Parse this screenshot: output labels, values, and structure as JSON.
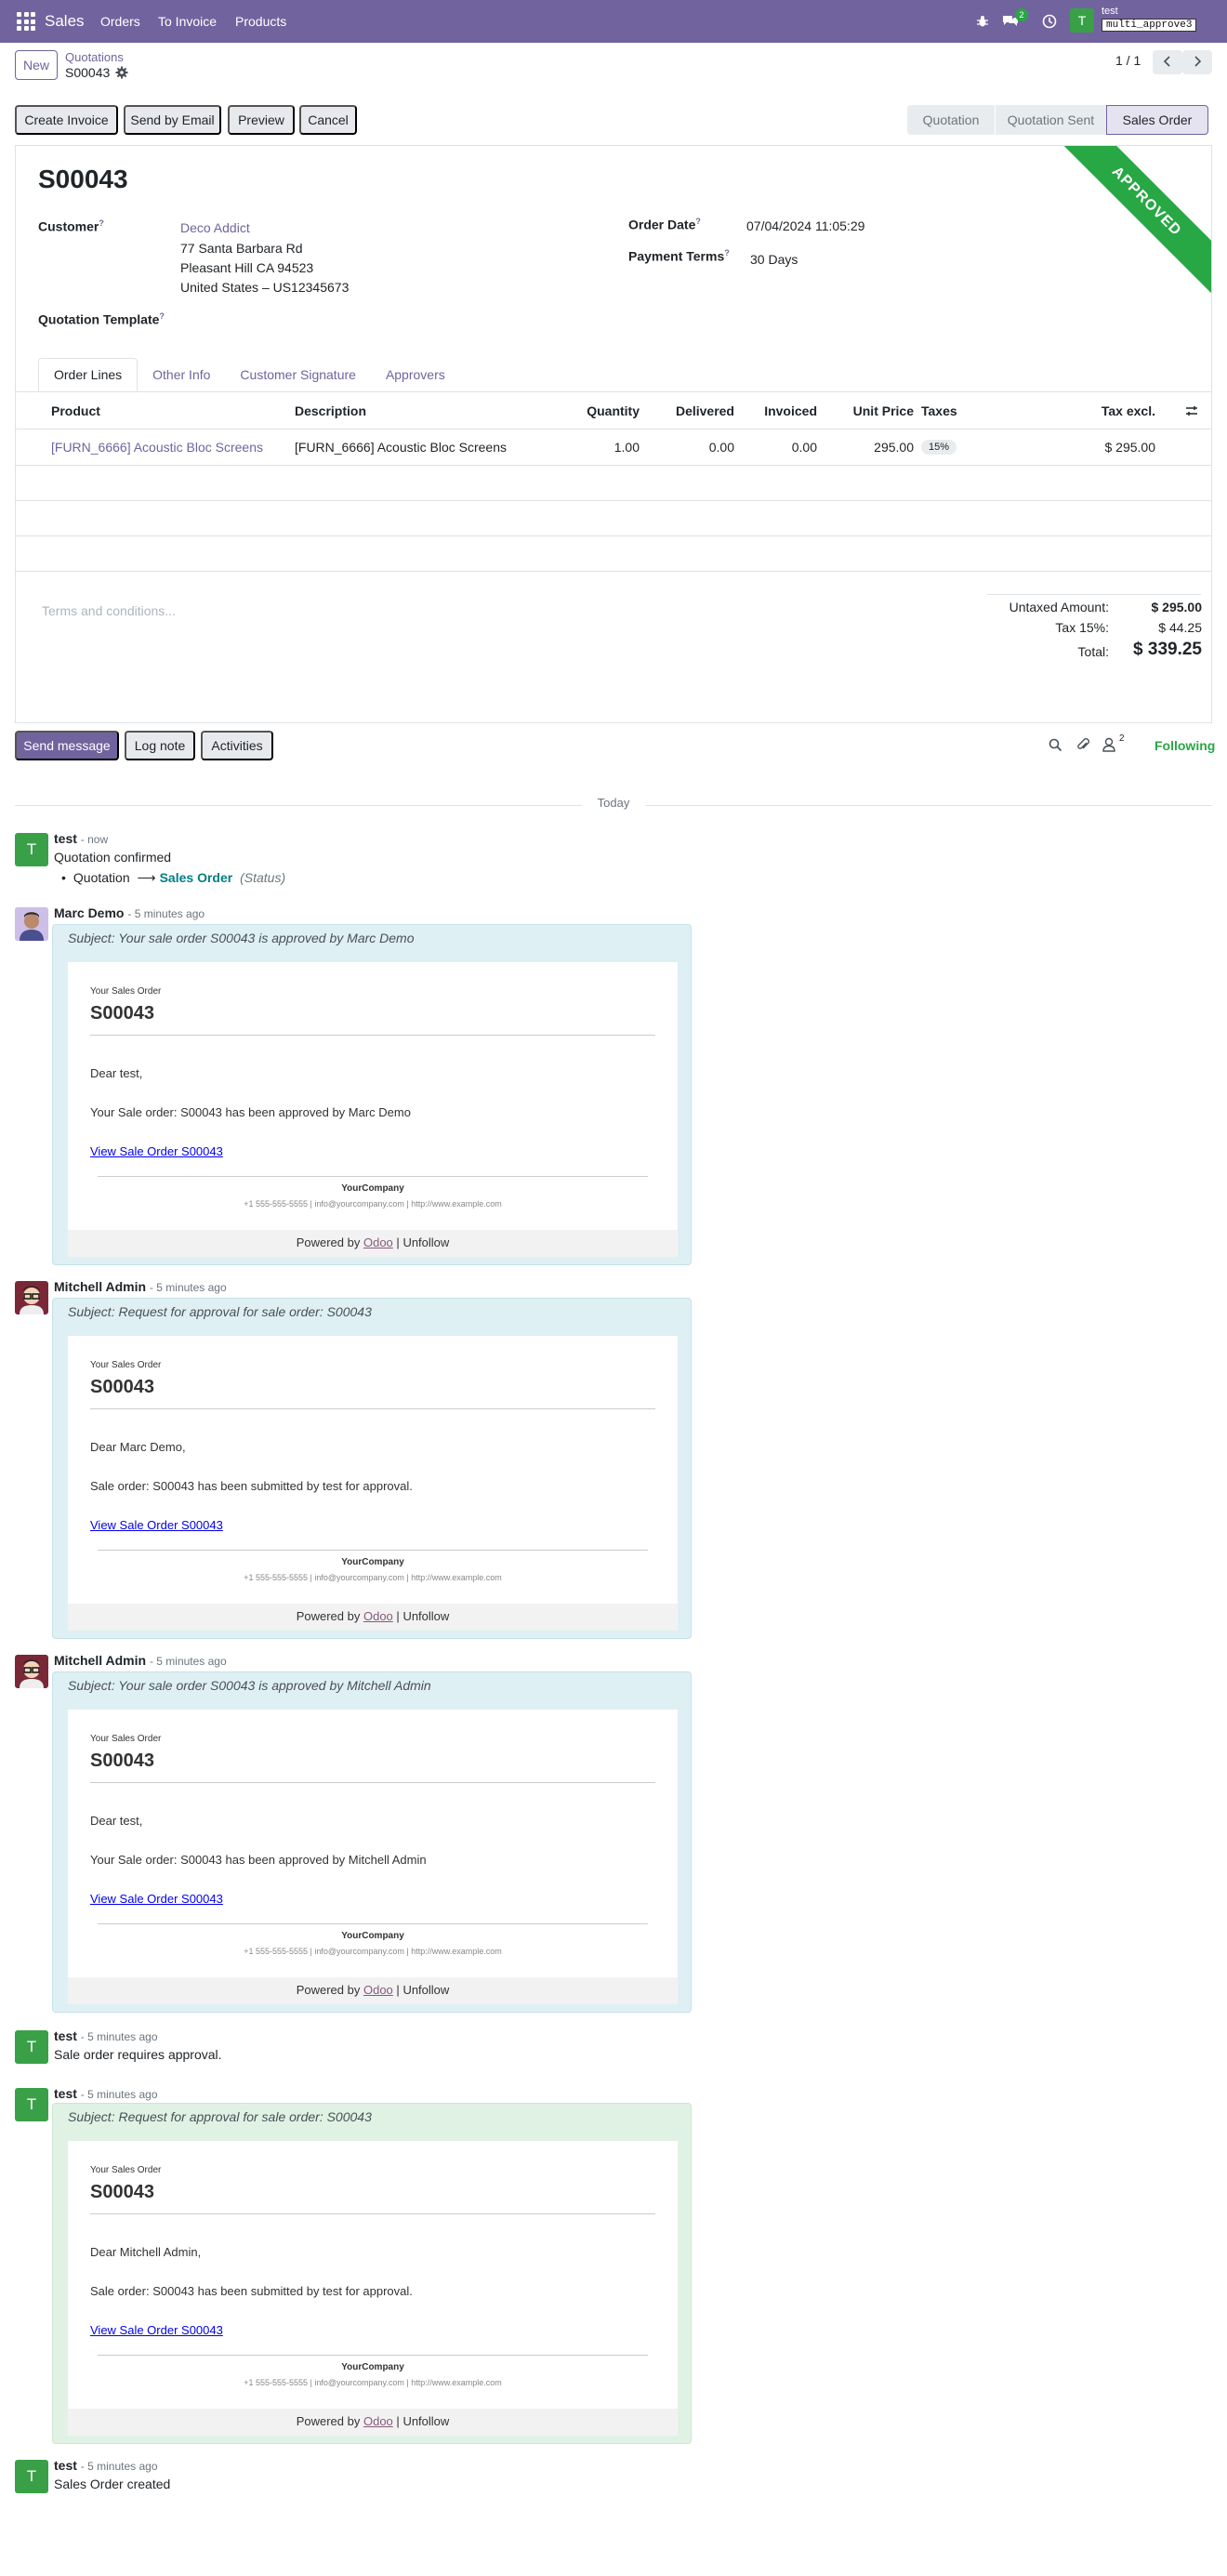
{
  "navbar": {
    "app": "Sales",
    "menu": [
      "Orders",
      "To Invoice",
      "Products"
    ],
    "chat_badge": "2",
    "avatar_letter": "T",
    "user": "test",
    "database": "multi_approve3"
  },
  "control": {
    "new_label": "New",
    "breadcrumb_parent": "Quotations",
    "breadcrumb_current": "S00043",
    "pager": "1 / 1"
  },
  "actions": {
    "create_invoice": "Create Invoice",
    "send_email": "Send by Email",
    "preview": "Preview",
    "cancel": "Cancel"
  },
  "statusbar": [
    "Quotation",
    "Quotation Sent",
    "Sales Order"
  ],
  "form": {
    "ribbon": "APPROVED",
    "name": "S00043",
    "customer_label": "Customer",
    "customer_name": "Deco Addict",
    "address1": "77 Santa Barbara Rd",
    "address2": "Pleasant Hill CA 94523",
    "address3": "United States – US12345673",
    "template_label": "Quotation Template",
    "order_date_label": "Order Date",
    "order_date": "07/04/2024 11:05:29",
    "payment_terms_label": "Payment Terms",
    "payment_terms": "30 Days",
    "help_mark": "?"
  },
  "tabs": [
    "Order Lines",
    "Other Info",
    "Customer Signature",
    "Approvers"
  ],
  "lines": {
    "headers": {
      "product": "Product",
      "description": "Description",
      "quantity": "Quantity",
      "delivered": "Delivered",
      "invoiced": "Invoiced",
      "unit_price": "Unit Price",
      "taxes": "Taxes",
      "tax_excl": "Tax excl."
    },
    "row": {
      "product": "[FURN_6666] Acoustic Bloc Screens",
      "description": "[FURN_6666] Acoustic Bloc Screens",
      "quantity": "1.00",
      "delivered": "0.00",
      "invoiced": "0.00",
      "unit_price": "295.00",
      "taxes": "15%",
      "tax_excl": "$ 295.00"
    }
  },
  "terms_placeholder": "Terms and conditions...",
  "totals": {
    "untaxed_label": "Untaxed Amount:",
    "untaxed": "$ 295.00",
    "tax_label": "Tax 15%:",
    "tax": "$ 44.25",
    "total_label": "Total:",
    "total": "$ 339.25"
  },
  "chatter": {
    "send_message": "Send message",
    "log_note": "Log note",
    "activities": "Activities",
    "followers_count": "2",
    "following": "Following",
    "today": "Today"
  },
  "messages": {
    "m1": {
      "author": "test",
      "ago": "- now",
      "text": "Quotation confirmed",
      "from": "Quotation",
      "to": "Sales Order",
      "field": "(Status)"
    },
    "m2": {
      "author": "Marc Demo",
      "ago": "- 5 minutes ago",
      "subject": "Subject: Your sale order S00043 is approved by Marc Demo",
      "small": "Your Sales Order",
      "title": "S00043",
      "greeting": "Dear test,",
      "body": "Your Sale order: S00043 has been approved by Marc Demo",
      "link": "View Sale Order S00043"
    },
    "m3": {
      "author": "Mitchell Admin",
      "ago": "- 5 minutes ago",
      "subject": "Subject: Request for approval for sale order: S00043",
      "small": "Your Sales Order",
      "title": "S00043",
      "greeting": "Dear Marc Demo,",
      "body": "Sale order: S00043 has been submitted by test for approval.",
      "link": "View Sale Order S00043"
    },
    "m4": {
      "author": "Mitchell Admin",
      "ago": "- 5 minutes ago",
      "subject": "Subject: Your sale order S00043 is approved by Mitchell Admin",
      "small": "Your Sales Order",
      "title": "S00043",
      "greeting": "Dear test,",
      "body": "Your Sale order: S00043 has been approved by Mitchell Admin",
      "link": "View Sale Order S00043"
    },
    "m5": {
      "author": "test",
      "ago": "- 5 minutes ago",
      "text": "Sale order requires approval."
    },
    "m6": {
      "author": "test",
      "ago": "- 5 minutes ago",
      "subject": "Subject: Request for approval for sale order: S00043",
      "small": "Your Sales Order",
      "title": "S00043",
      "greeting": "Dear Mitchell Admin,",
      "body": "Sale order: S00043 has been submitted by test for approval.",
      "link": "View Sale Order S00043"
    },
    "m7": {
      "author": "test",
      "ago": "- 5 minutes ago",
      "text": "Sales Order created"
    }
  },
  "mail_footer": {
    "company": "YourCompany",
    "contact": "+1 555-555-5555 | info@yourcompany.com | http://www.example.com",
    "powered_by": "Powered by",
    "odoo": "Odoo",
    "separator": "|",
    "unfollow": "Unfollow"
  },
  "colors": {
    "brand": "#71639e",
    "approved": "#28a745",
    "avatar": "#39a048"
  }
}
